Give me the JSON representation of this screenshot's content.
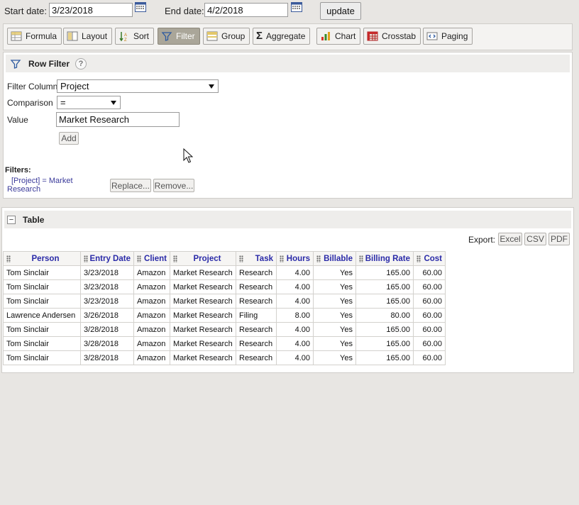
{
  "date_range": {
    "start_label": "Start date:",
    "start_value": "3/23/2018",
    "end_label": "End date:",
    "end_value": "4/2/2018",
    "update_label": "update"
  },
  "toolbar": {
    "formula": "Formula",
    "layout": "Layout",
    "sort": "Sort",
    "filter": "Filter",
    "group": "Group",
    "aggregate": "Aggregate",
    "chart": "Chart",
    "crosstab": "Crosstab",
    "paging": "Paging",
    "active_item": "Filter"
  },
  "row_filter": {
    "title": "Row Filter",
    "help": "?",
    "filter_column_label": "Filter Column",
    "filter_column_value": "Project",
    "comparison_label": "Comparison",
    "comparison_value": "=",
    "value_label": "Value",
    "value_input": "Market Research",
    "add_label": "Add",
    "filters_label": "Filters:",
    "filter_line1": "[Project] = Market",
    "filter_line2": "Research",
    "replace_label": "Replace...",
    "remove_label": "Remove..."
  },
  "table_section": {
    "title": "Table",
    "collapse": "−",
    "export_label": "Export:",
    "excel": "Excel",
    "csv": "CSV",
    "pdf": "PDF"
  },
  "table": {
    "columns": [
      "Person",
      "Entry Date",
      "Client",
      "Project",
      "Task",
      "Hours",
      "Billable",
      "Billing Rate",
      "Cost"
    ],
    "rows": [
      [
        "Tom Sinclair",
        "3/23/2018",
        "Amazon",
        "Market Research",
        "Research",
        "4.00",
        "Yes",
        "165.00",
        "60.00"
      ],
      [
        "Tom Sinclair",
        "3/23/2018",
        "Amazon",
        "Market Research",
        "Research",
        "4.00",
        "Yes",
        "165.00",
        "60.00"
      ],
      [
        "Tom Sinclair",
        "3/23/2018",
        "Amazon",
        "Market Research",
        "Research",
        "4.00",
        "Yes",
        "165.00",
        "60.00"
      ],
      [
        "Lawrence Andersen",
        "3/26/2018",
        "Amazon",
        "Market Research",
        "Filing",
        "8.00",
        "Yes",
        "80.00",
        "60.00"
      ],
      [
        "Tom Sinclair",
        "3/28/2018",
        "Amazon",
        "Market Research",
        "Research",
        "4.00",
        "Yes",
        "165.00",
        "60.00"
      ],
      [
        "Tom Sinclair",
        "3/28/2018",
        "Amazon",
        "Market Research",
        "Research",
        "4.00",
        "Yes",
        "165.00",
        "60.00"
      ],
      [
        "Tom Sinclair",
        "3/28/2018",
        "Amazon",
        "Market Research",
        "Research",
        "4.00",
        "Yes",
        "165.00",
        "60.00"
      ]
    ]
  },
  "colors": {
    "background": "#e8e6e3",
    "active_button": "#aaa699",
    "header_text": "#2a2aa8",
    "filter_text": "#3a3a9a"
  }
}
